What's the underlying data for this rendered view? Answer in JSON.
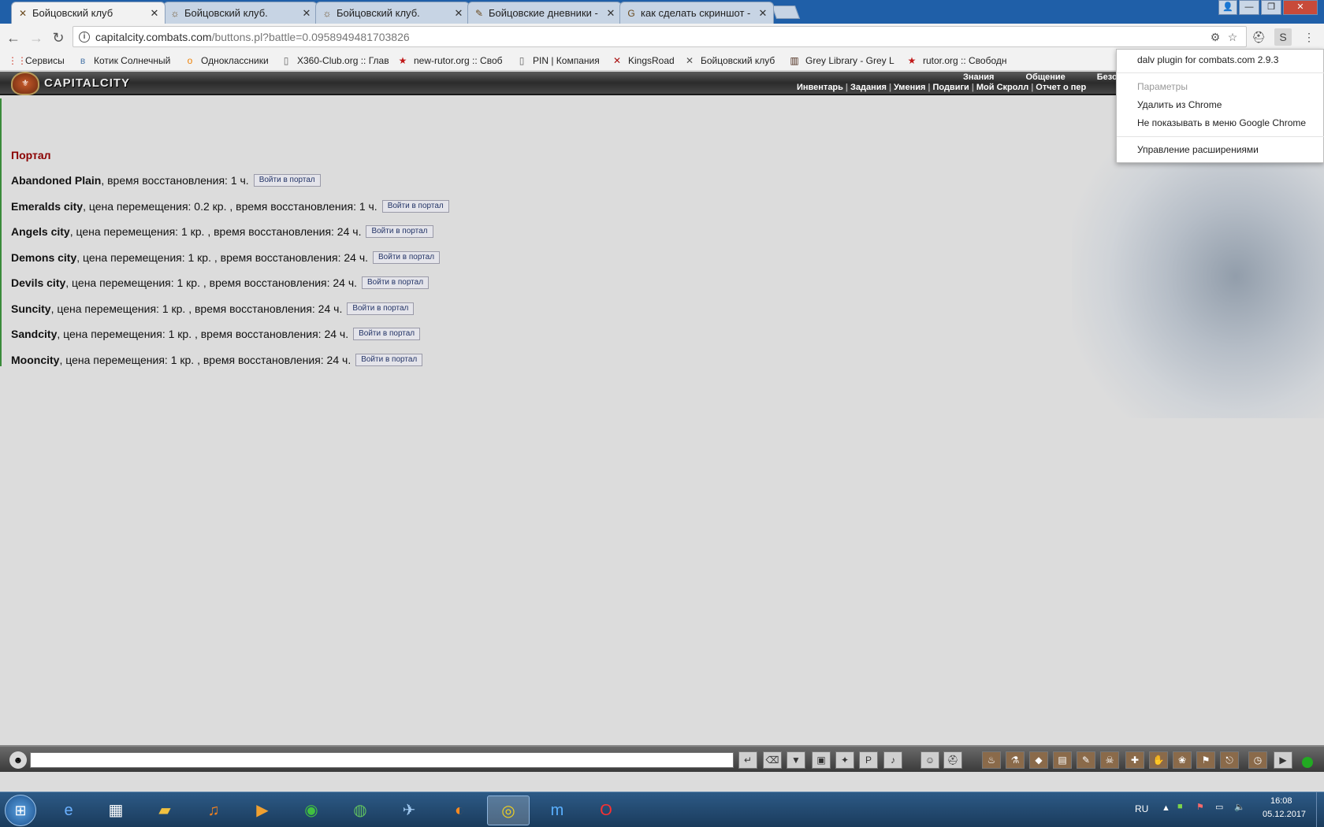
{
  "tabs": [
    {
      "title": "Бойцовский клуб",
      "icon": "crossed-swords-icon",
      "glyph": "✕",
      "active": true
    },
    {
      "title": "Бойцовский клуб.",
      "icon": "shield-icon",
      "glyph": "☼",
      "active": false
    },
    {
      "title": "Бойцовский клуб.",
      "icon": "shield-icon",
      "glyph": "☼",
      "active": false
    },
    {
      "title": "Бойцовские дневники -",
      "icon": "quill-icon",
      "glyph": "✎",
      "active": false
    },
    {
      "title": "как сделать скриншот -",
      "icon": "google-icon",
      "glyph": "G",
      "active": false
    }
  ],
  "address": {
    "host": "capitalcity.combats.com",
    "path": "/buttons.pl?battle=0.0958949481703826"
  },
  "bookmarks": [
    {
      "label": "Сервисы",
      "icon": "apps-grid-icon",
      "glyph": "⋮⋮",
      "color": "#d03a2a"
    },
    {
      "label": "Котик Солнечный",
      "icon": "vk-icon",
      "glyph": "в",
      "color": "#4a76a8"
    },
    {
      "label": "Одноклассники",
      "icon": "ok-icon",
      "glyph": "о",
      "color": "#ee8208"
    },
    {
      "label": "X360-Club.org :: Глав",
      "icon": "page-icon",
      "glyph": "▯",
      "color": "#666666"
    },
    {
      "label": "new-rutor.org :: Своб",
      "icon": "rutor-icon",
      "glyph": "★",
      "color": "#c01818"
    },
    {
      "label": "PIN | Компания",
      "icon": "page-icon",
      "glyph": "▯",
      "color": "#666666"
    },
    {
      "label": "KingsRoad",
      "icon": "kingsroad-icon",
      "glyph": "✕",
      "color": "#aa1111"
    },
    {
      "label": "Бойцовский клуб",
      "icon": "crossed-swords-icon",
      "glyph": "✕",
      "color": "#555555"
    },
    {
      "label": "Grey Library - Grey L",
      "icon": "library-icon",
      "glyph": "▥",
      "color": "#4a2a1a"
    },
    {
      "label": "rutor.org :: Свободн",
      "icon": "rutor-icon",
      "glyph": "★",
      "color": "#c01818"
    }
  ],
  "game": {
    "logo": "CAPITALCITY",
    "top_menu": [
      "Знания",
      "Общение",
      "Безоп"
    ],
    "sub_menu": [
      "Инвентарь",
      "Задания",
      "Умения",
      "Подвиги",
      "Мой Скролл",
      "Отчет о пер"
    ]
  },
  "portal": {
    "title": "Портал",
    "button_label": "Войти в портал",
    "cities": [
      {
        "name": "Abandoned Plain",
        "details": ", время восстановления: 1 ч."
      },
      {
        "name": "Emeralds city",
        "details": ", цена перемещения: 0.2 кр. , время восстановления: 1 ч."
      },
      {
        "name": "Angels city",
        "details": ", цена перемещения: 1 кр. , время восстановления: 24 ч."
      },
      {
        "name": "Demons city",
        "details": ", цена перемещения: 1 кр. , время восстановления: 24 ч."
      },
      {
        "name": "Devils city",
        "details": ", цена перемещения: 1 кр. , время восстановления: 24 ч."
      },
      {
        "name": "Suncity",
        "details": ", цена перемещения: 1 кр. , время восстановления: 24 ч."
      },
      {
        "name": "Sandcity",
        "details": ", цена перемещения: 1 кр. , время восстановления: 24 ч."
      },
      {
        "name": "Mooncity",
        "details": ", цена перемещения: 1 кр. , время восстановления: 24 ч."
      }
    ]
  },
  "extension_menu": {
    "title": "dalv plugin for combats.com 2.9.3",
    "params": "Параметры",
    "remove": "Удалить из Chrome",
    "hide": "Не показывать в меню Google Chrome",
    "manage": "Управление расширениями"
  },
  "taskbar": {
    "language": "RU",
    "time": "16:08",
    "date": "05.12.2017"
  }
}
